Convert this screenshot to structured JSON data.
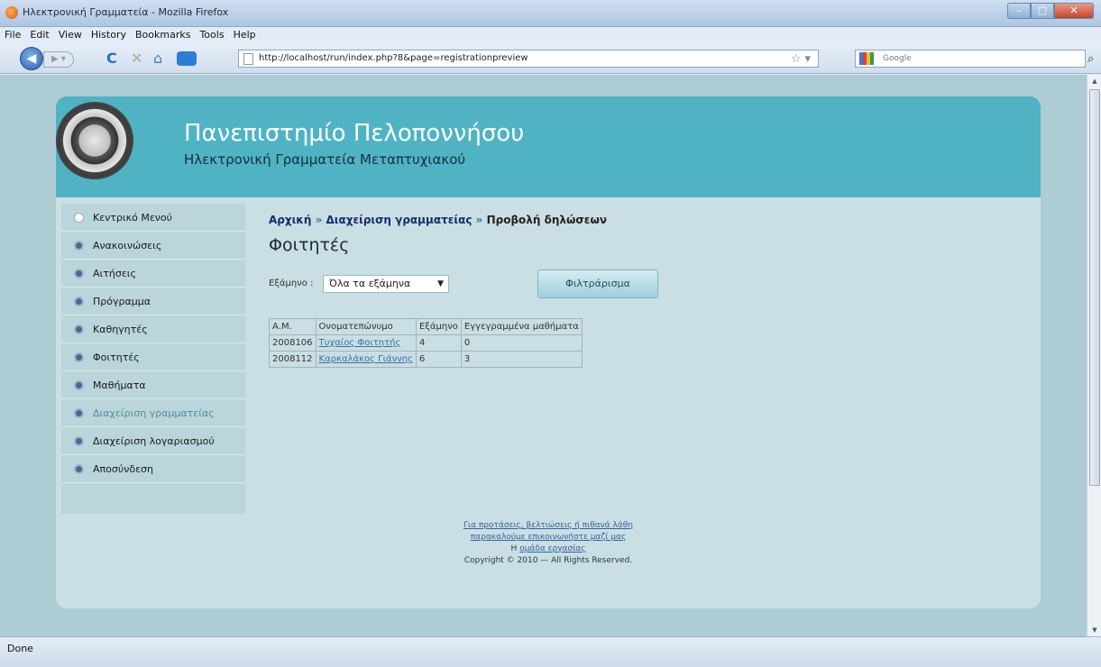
{
  "window": {
    "title": "Ηλεκτρονική Γραμματεία - Mozilla Firefox"
  },
  "menu": [
    "File",
    "Edit",
    "View",
    "History",
    "Bookmarks",
    "Tools",
    "Help"
  ],
  "toolbar": {
    "url": "http://localhost/run/index.php?8&page=registrationpreview",
    "search_placeholder": "Google"
  },
  "header": {
    "title": "Πανεπιστημίο Πελοποννήσου",
    "subtitle": "Ηλεκτρονική Γραμματεία Μεταπτυχιακού"
  },
  "sidebar": {
    "items": [
      {
        "label": "Κεντρικό Μενού"
      },
      {
        "label": "Ανακοινώσεις"
      },
      {
        "label": "Αιτήσεις"
      },
      {
        "label": "Πρόγραμμα"
      },
      {
        "label": "Καθηγητές"
      },
      {
        "label": "Φοιτητές"
      },
      {
        "label": "Μαθήματα"
      },
      {
        "label": "Διαχείριση γραμματείας"
      },
      {
        "label": "Διαχείριση λογαριασμού"
      },
      {
        "label": "Αποσύνδεση"
      }
    ]
  },
  "breadcrumb": {
    "home": "Αρχική",
    "sep1": "»",
    "level2": "Διαχείριση γραμματείας",
    "sep2": "»",
    "current": "Προβολή δηλώσεων"
  },
  "page_title": "Φοιτητές",
  "filter": {
    "label": "Εξάμηνο :",
    "selected": "Όλα τα εξάμηνα",
    "button": "Φιλτράρισμα"
  },
  "table": {
    "headers": [
      "Α.Μ.",
      "Ονοματεπώνυμο",
      "Εξάμηνο",
      "Εγγεγραμμένα μαθήματα"
    ],
    "rows": [
      [
        "2008106",
        "Τυχαίος Φοιτητής",
        "4",
        "0"
      ],
      [
        "2008112",
        "Καρκαλάκος Γιάννης",
        "6",
        "3"
      ]
    ]
  },
  "footer": {
    "line1": "Για προτάσεις, βελτιώσεις ή πιθανά λάθη",
    "line2": "παρακαλούμε επικοινωνήστε μαζί μας",
    "line3_prefix": "Η",
    "line3_link": "ομάδα εργασίας",
    "copyright": "Copyright © 2010 — All Rights Reserved."
  },
  "status": "Done",
  "colors": {
    "header": "#4fb3c4",
    "page_bg": "#c9dfe3",
    "viewport_bg": "#aeccd3"
  }
}
